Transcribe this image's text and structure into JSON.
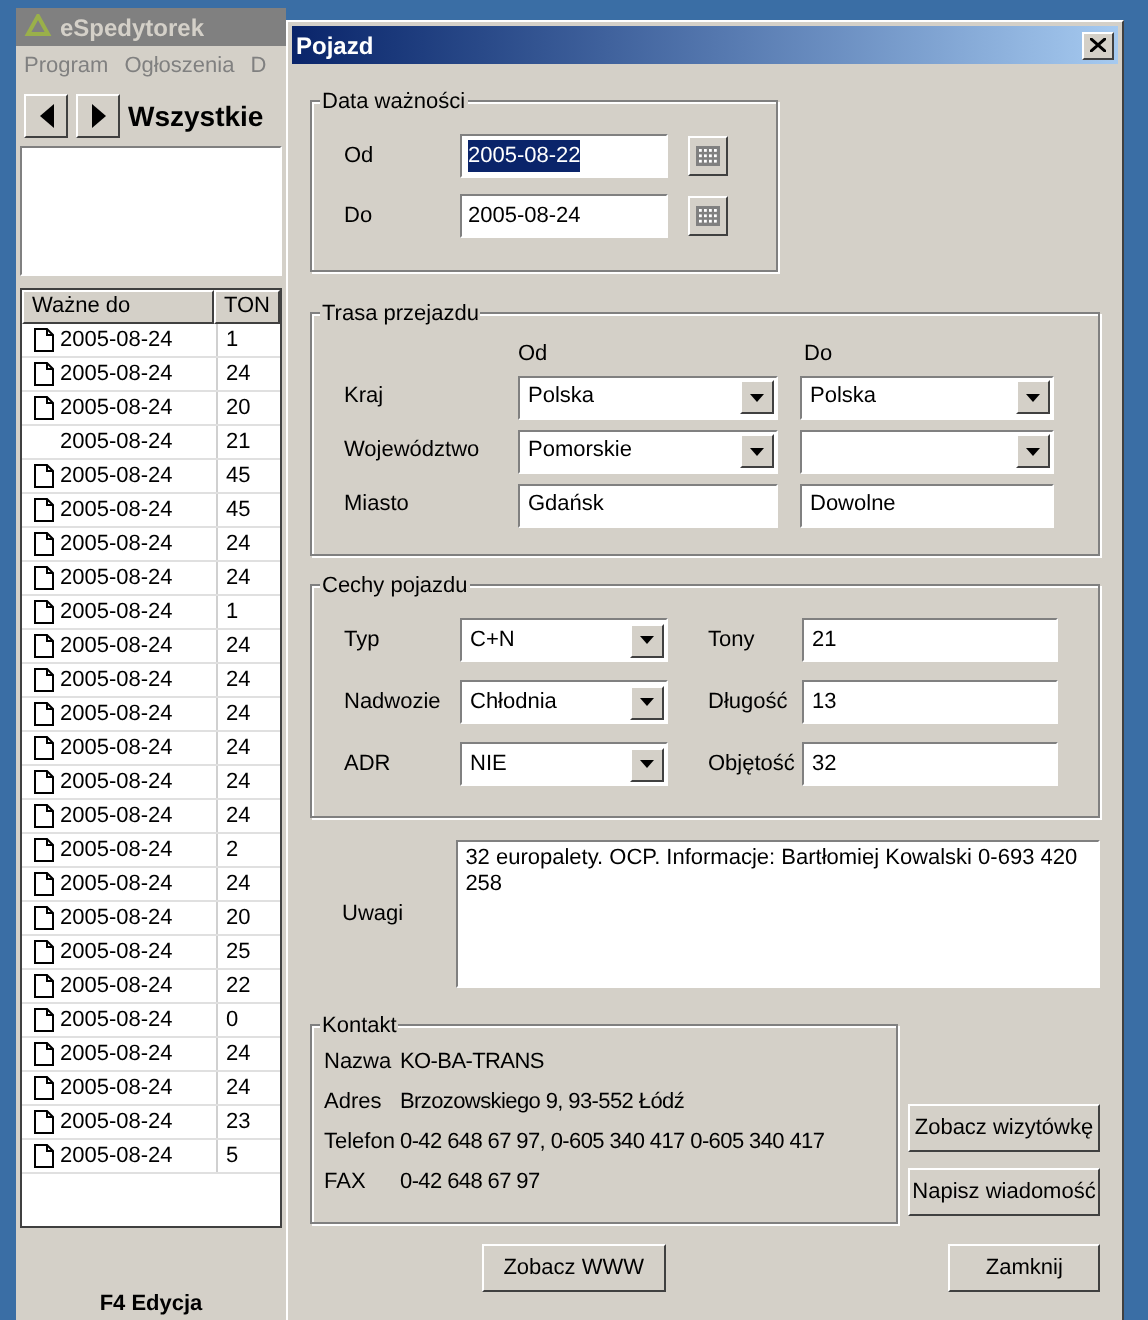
{
  "background_window": {
    "title": "eSpedytorek",
    "menu": [
      "Program",
      "Ogłoszenia",
      "D"
    ],
    "toolbar_title": "Wszystkie",
    "table": {
      "columns": [
        "Ważne do",
        "TON"
      ],
      "rows": [
        {
          "date": "2005-08-24",
          "ton": "1",
          "icon": true
        },
        {
          "date": "2005-08-24",
          "ton": "24",
          "icon": true
        },
        {
          "date": "2005-08-24",
          "ton": "20",
          "icon": true
        },
        {
          "date": "2005-08-24",
          "ton": "21",
          "icon": false
        },
        {
          "date": "2005-08-24",
          "ton": "45",
          "icon": true
        },
        {
          "date": "2005-08-24",
          "ton": "45",
          "icon": true
        },
        {
          "date": "2005-08-24",
          "ton": "24",
          "icon": true
        },
        {
          "date": "2005-08-24",
          "ton": "24",
          "icon": true
        },
        {
          "date": "2005-08-24",
          "ton": "1",
          "icon": true
        },
        {
          "date": "2005-08-24",
          "ton": "24",
          "icon": true
        },
        {
          "date": "2005-08-24",
          "ton": "24",
          "icon": true
        },
        {
          "date": "2005-08-24",
          "ton": "24",
          "icon": true
        },
        {
          "date": "2005-08-24",
          "ton": "24",
          "icon": true
        },
        {
          "date": "2005-08-24",
          "ton": "24",
          "icon": true
        },
        {
          "date": "2005-08-24",
          "ton": "24",
          "icon": true
        },
        {
          "date": "2005-08-24",
          "ton": "2",
          "icon": true
        },
        {
          "date": "2005-08-24",
          "ton": "24",
          "icon": true
        },
        {
          "date": "2005-08-24",
          "ton": "20",
          "icon": true
        },
        {
          "date": "2005-08-24",
          "ton": "25",
          "icon": true
        },
        {
          "date": "2005-08-24",
          "ton": "22",
          "icon": true
        },
        {
          "date": "2005-08-24",
          "ton": "0",
          "icon": true
        },
        {
          "date": "2005-08-24",
          "ton": "24",
          "icon": true
        },
        {
          "date": "2005-08-24",
          "ton": "24",
          "icon": true
        },
        {
          "date": "2005-08-24",
          "ton": "23",
          "icon": true
        },
        {
          "date": "2005-08-24",
          "ton": "5",
          "icon": true
        }
      ]
    },
    "footer": "F4 Edycja"
  },
  "dialog": {
    "title": "Pojazd",
    "validity": {
      "legend": "Data ważności",
      "from_label": "Od",
      "from_value": "2005-08-22",
      "to_label": "Do",
      "to_value": "2005-08-24"
    },
    "route": {
      "legend": "Trasa przejazdu",
      "col_from": "Od",
      "col_to": "Do",
      "rows": [
        {
          "label": "Kraj",
          "kind": "select",
          "from": "Polska",
          "to": "Polska"
        },
        {
          "label": "Województwo",
          "kind": "select",
          "from": "Pomorskie",
          "to": ""
        },
        {
          "label": "Miasto",
          "kind": "text",
          "from": "Gdańsk",
          "to": "Dowolne"
        }
      ]
    },
    "vehicle": {
      "legend": "Cechy pojazdu",
      "rows": [
        {
          "label": "Typ",
          "value": "C+N",
          "label2": "Tony",
          "value2": "21"
        },
        {
          "label": "Nadwozie",
          "value": "Chłodnia",
          "label2": "Długość",
          "value2": "13"
        },
        {
          "label": "ADR",
          "value": "NIE",
          "label2": "Objętość",
          "value2": "32"
        }
      ]
    },
    "notes": {
      "label": "Uwagi",
      "value": "32 europalety. OCP. Informacje: Bartłomiej Kowalski 0-693 420 258"
    },
    "contact": {
      "legend": "Kontakt",
      "rows": [
        {
          "label": "Nazwa",
          "value": "KO-BA-TRANS"
        },
        {
          "label": "Adres",
          "value": "Brzozowskiego 9, 93-552 Łódź"
        },
        {
          "label": "Telefon",
          "value": "0-42 648 67 97, 0-605 340 417 0-605 340 417"
        },
        {
          "label": "FAX",
          "value": "0-42 648 67 97"
        }
      ]
    },
    "side_buttons": [
      "Zobacz wizytówkę",
      "Napisz wiadomość"
    ],
    "bottom_buttons": [
      "Zobacz WWW",
      "Zamknij"
    ]
  }
}
